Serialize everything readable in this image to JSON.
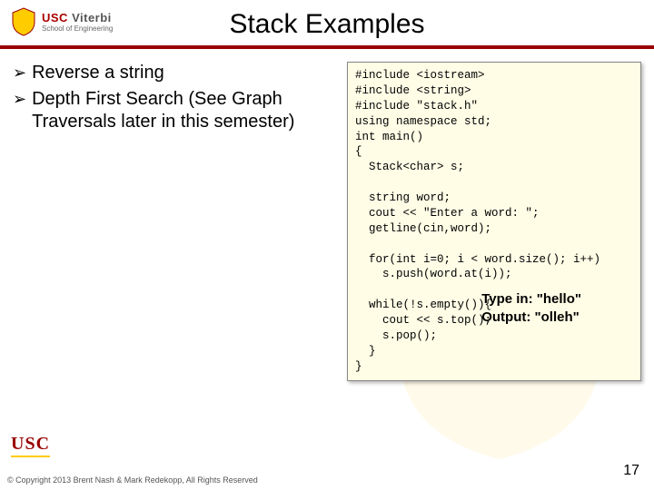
{
  "header": {
    "logo_main": "USC",
    "logo_brand": "Viterbi",
    "logo_sub": "School of Engineering"
  },
  "title": "Stack Examples",
  "bullets": [
    "Reverse a string",
    "Depth First Search (See Graph Traversals later in this semester)"
  ],
  "code": "#include <iostream>\n#include <string>\n#include \"stack.h\"\nusing namespace std;\nint main()\n{\n  Stack<char> s;\n\n  string word;\n  cout << \"Enter a word: \";\n  getline(cin,word);\n\n  for(int i=0; i < word.size(); i++)\n    s.push(word.at(i));\n\n  while(!s.empty()){\n    cout << s.top();\n    s.pop();\n  }\n}",
  "result": {
    "line1": "Type in: \"hello\"",
    "line2": "Output: \"olleh\""
  },
  "footer_logo": "USC",
  "copyright": "© Copyright 2013 Brent Nash & Mark Redekopp, All Rights Reserved",
  "page": "17"
}
